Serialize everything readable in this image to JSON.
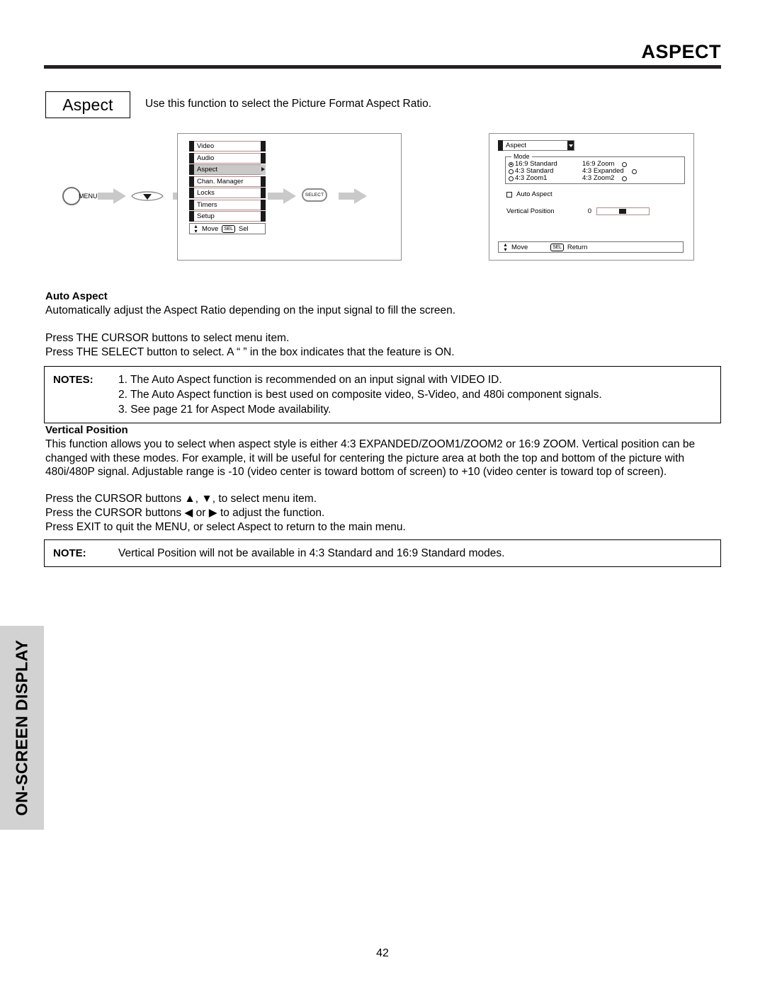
{
  "header": {
    "title": "ASPECT"
  },
  "intro": {
    "chip_label": "Aspect",
    "description": "Use this function to select the Picture Format Aspect Ratio."
  },
  "diagram": {
    "menu_button_label": "MENU",
    "select_button_label": "SELECT",
    "left_osd": {
      "items": [
        "Video",
        "Audio",
        "Aspect",
        "Chan. Manager",
        "Locks",
        "Timers",
        "Setup"
      ],
      "selected_item": "Aspect",
      "footer": {
        "move_label": "Move",
        "sel_key": "SEL",
        "action_label": "Sel"
      }
    },
    "right_osd": {
      "title": "Aspect",
      "mode_legend": "Mode",
      "modes_left": [
        {
          "label": "16:9 Standard",
          "selected": true
        },
        {
          "label": "4:3 Standard",
          "selected": false
        },
        {
          "label": "4:3 Zoom1",
          "selected": false
        }
      ],
      "modes_right": [
        {
          "label": "16:9 Zoom",
          "selected": false
        },
        {
          "label": "4:3 Expanded",
          "selected": false
        },
        {
          "label": "4:3 Zoom2",
          "selected": false
        }
      ],
      "auto_aspect_label": "Auto Aspect",
      "auto_aspect_checked": false,
      "vertical_position_label": "Vertical Position",
      "vertical_position_value": "0",
      "footer": {
        "move_label": "Move",
        "sel_key": "SEL",
        "action_label": "Return"
      }
    }
  },
  "auto_aspect": {
    "heading": "Auto Aspect",
    "description": "Automatically adjust the Aspect Ratio depending on the input signal to fill the screen.",
    "instruction_1": "Press THE CURSOR buttons to select menu item.",
    "instruction_2": "Press THE SELECT button to select.  A “ ” in the box indicates that the feature is ON."
  },
  "notes_box": {
    "label": "NOTES:",
    "items": [
      "1. The Auto Aspect function is recommended on an input signal with VIDEO ID.",
      "2. The Auto Aspect function is best used on composite video, S-Video, and 480i component signals.",
      "3. See page 21 for Aspect Mode availability."
    ]
  },
  "vertical_position": {
    "heading": "Vertical Position",
    "paragraph_line_1": "This function allows you to select when aspect style is either 4:3 EXPANDED/ZOOM1/ZOOM2 or 16:9 ZOOM.  Vertical position can be",
    "paragraph_line_2": "changed with these modes.  For example, it will be useful for centering the picture area at both the top and bottom of the picture with",
    "paragraph_line_3": "480i/480P signal.  Adjustable range is -10 (video center is toward bottom of screen) to +10 (video center is toward top of screen).",
    "instruction_1": "Press the CURSOR buttons ▲, ▼, to select menu item.",
    "instruction_2": "Press the CURSOR buttons  ◀ or ▶ to adjust the function.",
    "instruction_3": "Press EXIT to quit the MENU, or select Aspect to return to the main menu."
  },
  "note_box": {
    "label": "NOTE:",
    "text": "Vertical Position will not be available in 4:3 Standard and 16:9 Standard modes."
  },
  "side_tab": {
    "label": "ON-SCREEN DISPLAY"
  },
  "footer": {
    "page_number": "42"
  }
}
